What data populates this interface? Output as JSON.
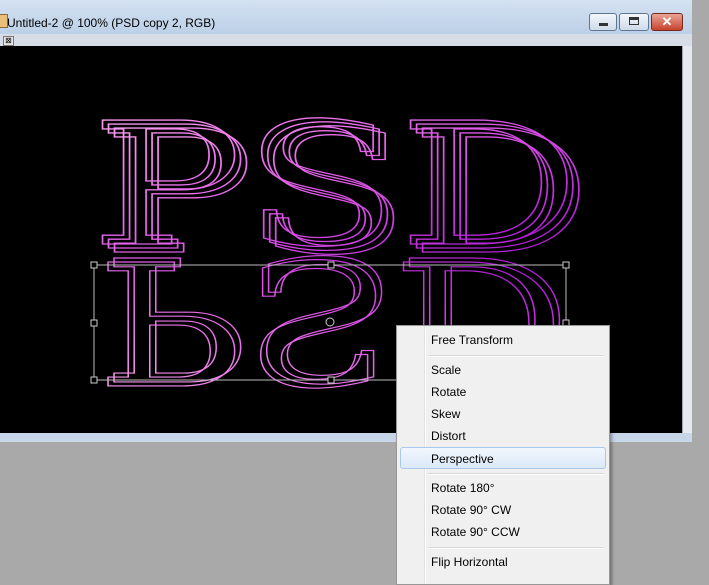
{
  "window": {
    "title": "Untitled-2 @ 100% (PSD copy 2, RGB)",
    "controls": [
      "minimize",
      "maximize",
      "close"
    ],
    "close_glyph": "✕"
  },
  "canvas": {
    "text": "PSD",
    "reflection_text": "PSD",
    "stroke_gradient": [
      "#ffaaf0",
      "#cc44dd",
      "#9a00cc"
    ],
    "background": "#000000"
  },
  "context_menu": {
    "items": [
      {
        "label": "Free Transform"
      },
      {
        "label": "Scale"
      },
      {
        "label": "Rotate"
      },
      {
        "label": "Skew"
      },
      {
        "label": "Distort"
      },
      {
        "label": "Perspective",
        "highlighted": true
      },
      {
        "label": "Rotate 180°"
      },
      {
        "label": "Rotate 90° CW"
      },
      {
        "label": "Rotate 90° CCW"
      },
      {
        "label": "Flip Horizontal"
      }
    ]
  }
}
